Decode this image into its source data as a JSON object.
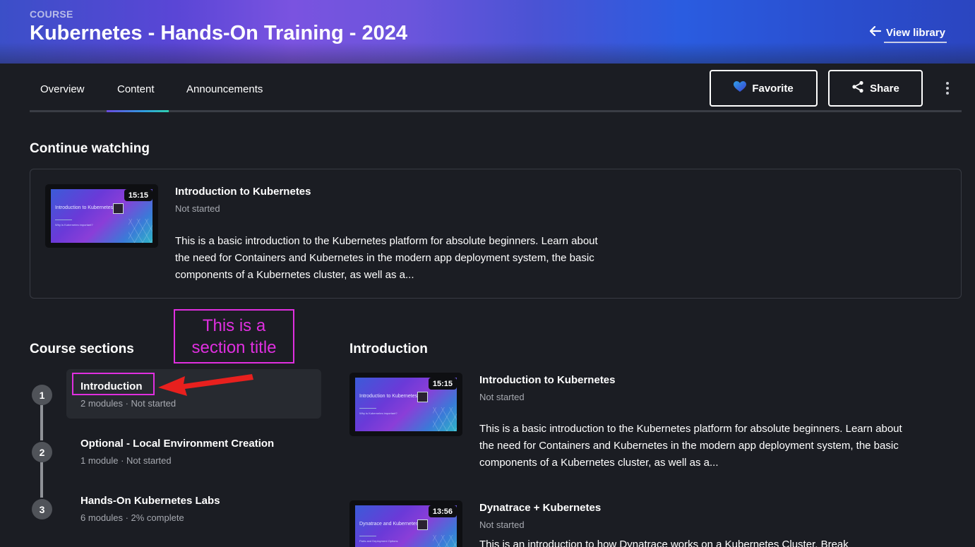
{
  "header": {
    "label": "COURSE",
    "title": "Kubernetes - Hands-On Training - 2024",
    "view_library": "View library"
  },
  "tabs": [
    {
      "label": "Overview"
    },
    {
      "label": "Content"
    },
    {
      "label": "Announcements"
    }
  ],
  "actions": {
    "favorite": "Favorite",
    "share": "Share"
  },
  "continue": {
    "heading": "Continue watching",
    "item": {
      "title": "Introduction to Kubernetes",
      "status": "Not started",
      "duration": "15:15",
      "description": "This is a basic introduction to the Kubernetes platform for absolute beginners. Learn about the need for Containers and Kubernetes in the modern app deployment system, the basic components of a Kubernetes cluster, as well as a...",
      "thumb_title": "Introduction to Kubernetes",
      "thumb_subtitle": "Why is Kubernetes important?"
    }
  },
  "sections": {
    "heading": "Course sections",
    "items": [
      {
        "num": "1",
        "title": "Introduction",
        "meta": "2 modules · Not started"
      },
      {
        "num": "2",
        "title": "Optional - Local Environment Creation",
        "meta": "1 module · Not started"
      },
      {
        "num": "3",
        "title": "Hands-On Kubernetes Labs",
        "meta": "6 modules · 2% complete"
      }
    ]
  },
  "detail": {
    "heading": "Introduction",
    "modules": [
      {
        "title": "Introduction to Kubernetes",
        "status": "Not started",
        "duration": "15:15",
        "description": "This is a basic introduction to the Kubernetes platform for absolute beginners. Learn about the need for Containers and Kubernetes in the modern app deployment system, the basic components of a Kubernetes cluster, as well as a...",
        "thumb_title": "Introduction to Kubernetes",
        "thumb_subtitle": "Why is Kubernetes important?"
      },
      {
        "title": "Dynatrace + Kubernetes",
        "status": "Not started",
        "duration": "13:56",
        "description": "This is an introduction to how Dynatrace works on a Kubernetes Cluster. Break",
        "thumb_title": "Dynatrace and Kubernetes",
        "thumb_subtitle": "Parts and Deployment Options"
      }
    ]
  },
  "annotation": {
    "text": "This is a section title"
  },
  "colors": {
    "annotation": "#e02fe0",
    "arrow": "#e8201e",
    "active_tab_gradient_start": "#6a4be0",
    "active_tab_gradient_end": "#2fd0b0",
    "favorite_heart": "#2f6fe0"
  }
}
